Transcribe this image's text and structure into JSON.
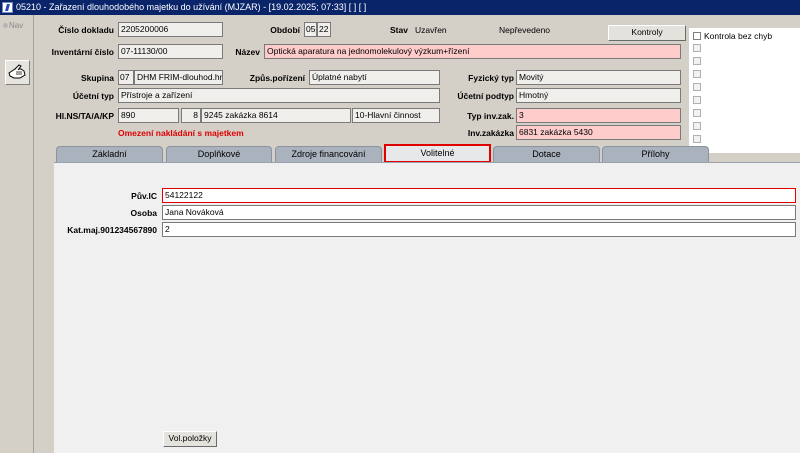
{
  "window": {
    "title": "05210 - Zařazení dlouhodobého majetku do užívání (MJZAR) - [19.02.2025; 07:33]  [ ]  [ ]"
  },
  "leftbar": {
    "nav_label": "Nav"
  },
  "header": {
    "cislo_dokladu_label": "Číslo dokladu",
    "cislo_dokladu_value": "2205200006",
    "obdobi_label": "Období",
    "obdobi_month": "05",
    "obdobi_year": "22",
    "stav_label": "Stav",
    "stav_value": "Uzavřen",
    "neprevedeno": "Nepřevedeno",
    "kontroly_button": "Kontroly",
    "inventarni_cislo_label": "Inventární číslo",
    "inventarni_cislo_value": "07-11130/00",
    "nazev_label": "Název",
    "nazev_value": "Optická aparatura na jednomolekulový výzkum+řízení",
    "skupina_label": "Skupina",
    "skupina_code": "07",
    "skupina_name": "DHM FRIM-dlouhod.hm",
    "zpus_porizeni_label": "Způs.pořízení",
    "zpus_porizeni_value": "Úplatné nabytí",
    "fyzicky_typ_label": "Fyzický typ",
    "fyzicky_typ_value": "Movitý",
    "ucetni_typ_label": "Účetní typ",
    "ucetni_typ_value": "Přístroje a zařízení",
    "ucetni_podtyp_label": "Účetní podtyp",
    "ucetni_podtyp_value": "Hmotný",
    "hlns_label": "Hl.NS/TA/A/KP",
    "hlns_ns": "890",
    "hlns_ta": "8",
    "hlns_zakazka": "9245 zakázka 8614",
    "hlns_kp": "10-Hlavní činnost",
    "typ_inv_zak_label": "Typ inv.zak.",
    "typ_inv_zak_value": "3",
    "omezeni": "Omezení nakládání s majetkem",
    "inv_zakazka_label": "Inv.zakázka",
    "inv_zakazka_value": "6831 zakázka 5430"
  },
  "checks": {
    "kontrola_bez_chyb": "Kontrola bez chyb"
  },
  "tabs": [
    "Základní",
    "Doplňkové",
    "Zdroje financování",
    "Volitelné",
    "Dotace",
    "Přílohy"
  ],
  "volitelne": {
    "puv_ic_label": "Pův.IC",
    "puv_ic_value": "54122122",
    "osoba_label": "Osoba",
    "osoba_value": "Jana Nováková",
    "kat_maj_label": "Kat.maj.901234567890",
    "kat_maj_value": "2",
    "vol_polozky_button": "Vol.položky"
  },
  "colors": {
    "titlebar": "#0a246a",
    "highlight_pink": "#ffcccc",
    "warning_red": "#e00000"
  }
}
